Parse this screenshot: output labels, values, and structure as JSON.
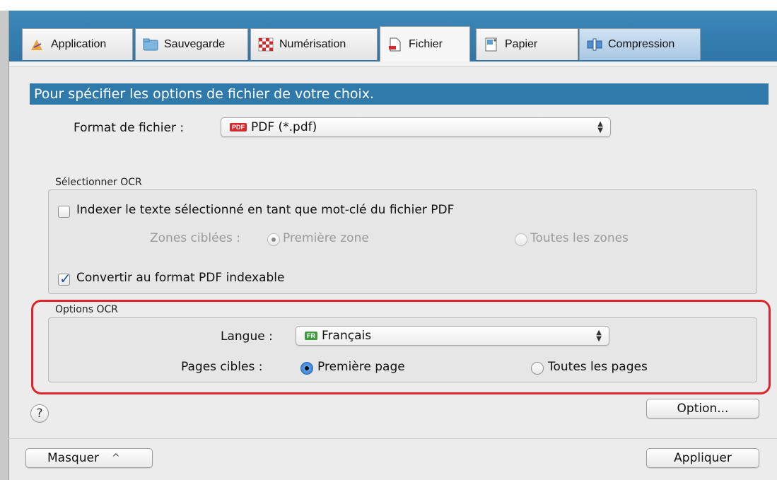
{
  "tabs": [
    {
      "label": "Application",
      "icon": "application-icon"
    },
    {
      "label": "Sauvegarde",
      "icon": "folder-icon"
    },
    {
      "label": "Numérisation",
      "icon": "scan-icon"
    },
    {
      "label": "Fichier",
      "icon": "file-icon",
      "active": true
    },
    {
      "label": "Papier",
      "icon": "paper-icon"
    },
    {
      "label": "Compression",
      "icon": "compression-icon"
    }
  ],
  "heading": "Pour spécifier les options de fichier de votre choix.",
  "file_format": {
    "label": "Format de fichier :",
    "badge": "PDF",
    "value": "PDF (*.pdf)"
  },
  "ocr_select": {
    "group_label": "Sélectionner OCR",
    "index_checkbox_label": "Indexer le texte sélectionné en tant que mot-clé du fichier PDF",
    "index_checked": false,
    "zones_label": "Zones ciblées :",
    "zone_first": "Première zone",
    "zone_all": "Toutes les zones",
    "convert_checkbox_label": "Convertir au format PDF indexable",
    "convert_checked": true
  },
  "ocr_options": {
    "group_label": "Options OCR",
    "language_label": "Langue :",
    "language_badge": "FR",
    "language_value": "Français",
    "pages_label": "Pages cibles :",
    "page_first": "Première page",
    "page_all": "Toutes les pages"
  },
  "help_label": "?",
  "option_button": "Option...",
  "hide_button": "Masquer",
  "hide_chevron": "^",
  "apply_button": "Appliquer",
  "colors": {
    "accent": "#2f79ab",
    "highlight": "#e0242a"
  }
}
